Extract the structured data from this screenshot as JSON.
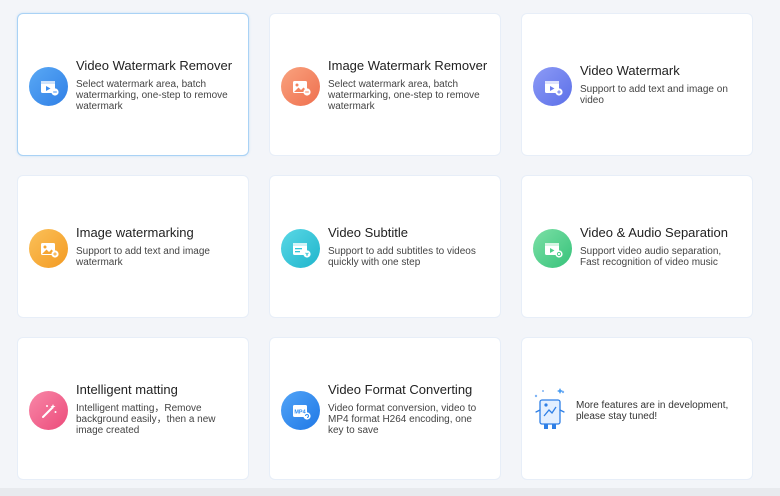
{
  "cards": [
    {
      "title": "Video Watermark Remover",
      "desc": "Select watermark area, batch watermarking, one-step to remove watermark",
      "icon": "video-watermark-remover-icon",
      "color": "#3d8ff0"
    },
    {
      "title": "Image Watermark Remover",
      "desc": "Select watermark area, batch watermarking, one-step to remove watermark",
      "icon": "image-watermark-remover-icon",
      "color": "#f4845f"
    },
    {
      "title": "Video Watermark",
      "desc": "Support to add text and image on video",
      "icon": "video-watermark-icon",
      "color": "#6d7ff0"
    },
    {
      "title": "Image watermarking",
      "desc": "Support to add text and image watermark",
      "icon": "image-watermarking-icon",
      "color": "#f6a531"
    },
    {
      "title": "Video Subtitle",
      "desc": "Support to add subtitles to videos quickly with one step",
      "icon": "video-subtitle-icon",
      "color": "#2fc6d8"
    },
    {
      "title": "Video & Audio Separation",
      "desc": "Support video audio separation, Fast recognition of video music",
      "icon": "video-audio-separation-icon",
      "color": "#4fd08a"
    },
    {
      "title": "Intelligent matting",
      "desc": "Intelligent matting，Remove background easily，then a new image created",
      "icon": "magic-wand-icon",
      "color": "#f2608a"
    },
    {
      "title": "Video Format Converting",
      "desc": "Video format conversion, video to MP4 format H264 encoding, one key to save",
      "icon": "mp4-convert-icon",
      "color": "#2e8df2",
      "badge": "MP4"
    }
  ],
  "dev": {
    "text": "More features are in development, please stay tuned!",
    "icon": "development-illustration-icon"
  }
}
